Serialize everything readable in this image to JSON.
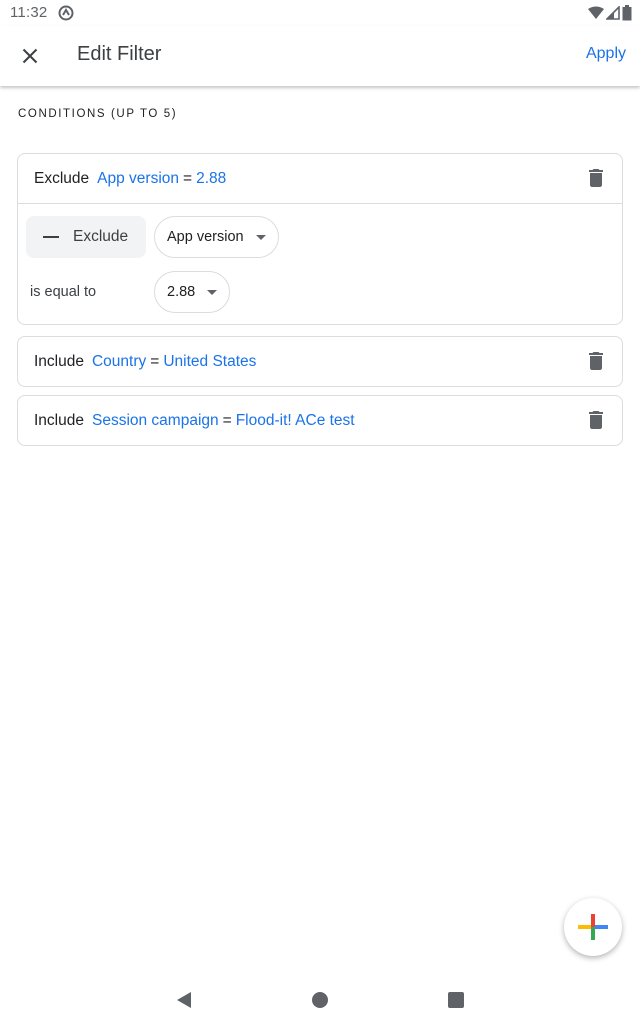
{
  "status_bar": {
    "time": "11:32"
  },
  "app_bar": {
    "title": "Edit Filter",
    "apply_label": "Apply",
    "close_icon": "close-icon"
  },
  "section": {
    "header": "CONDITIONS (UP TO 5)"
  },
  "conditions": [
    {
      "mode": "Exclude",
      "dimension": "App version",
      "operator_symbol": "=",
      "value": "2.88",
      "expanded": true,
      "editor": {
        "toggle_label": "Exclude",
        "dimension_select": "App version",
        "operator_label": "is equal to",
        "value_select": "2.88"
      }
    },
    {
      "mode": "Include",
      "dimension": "Country",
      "operator_symbol": "=",
      "value": "United States",
      "expanded": false
    },
    {
      "mode": "Include",
      "dimension": "Session campaign",
      "operator_symbol": "=",
      "value": "Flood-it! ACe test",
      "expanded": false
    }
  ],
  "fab": {
    "icon": "add-icon"
  },
  "colors": {
    "accent": "#1a73e8",
    "border": "#dadce0",
    "icon_gray": "#5f6368"
  }
}
